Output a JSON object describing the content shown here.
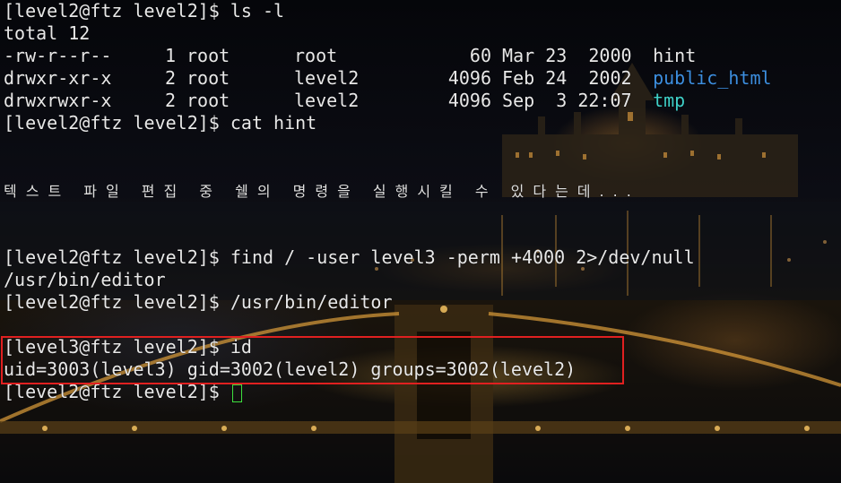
{
  "ls_command": {
    "prompt": "[level2@ftz level2]$",
    "command": "ls -l"
  },
  "total_line": "total 12",
  "listing": [
    {
      "perms": "-rw-r--r--",
      "links": "1",
      "owner": "root",
      "group": "root",
      "size": "60",
      "date": "Mar 23  2000",
      "name": "hint",
      "kind": "file"
    },
    {
      "perms": "drwxr-xr-x",
      "links": "2",
      "owner": "root",
      "group": "level2",
      "size": "4096",
      "date": "Feb 24  2002",
      "name": "public_html",
      "kind": "dir"
    },
    {
      "perms": "drwxrwxr-x",
      "links": "2",
      "owner": "root",
      "group": "level2",
      "size": "4096",
      "date": "Sep  3 22:07",
      "name": "tmp",
      "kind": "sticky-dir"
    }
  ],
  "cat_command": {
    "prompt": "[level2@ftz level2]$",
    "command": "cat hint"
  },
  "hint_text": "텍스트 파일 편집 중 쉘의 명령을 실행시킬 수 있다는데...",
  "find_command": {
    "prompt": "[level2@ftz level2]$",
    "command": "find / -user level3 -perm +4000 2>/dev/null"
  },
  "find_result": "/usr/bin/editor",
  "editor_command": {
    "prompt": "[level2@ftz level2]$",
    "command": "/usr/bin/editor"
  },
  "id_command": {
    "prompt": "[level3@ftz level2]$",
    "command": "id"
  },
  "id_result": "uid=3003(level3) gid=3002(level2) groups=3002(level2)",
  "final_prompt": "[level2@ftz level2]$",
  "colors": {
    "text": "#e8e8e8",
    "directory": "#3d8fe0",
    "writable_directory": "#3fd0c8",
    "cursor": "#3ee03e",
    "highlight_box": "#e02020"
  },
  "icons": {
    "cursor": "block-cursor-outline"
  }
}
